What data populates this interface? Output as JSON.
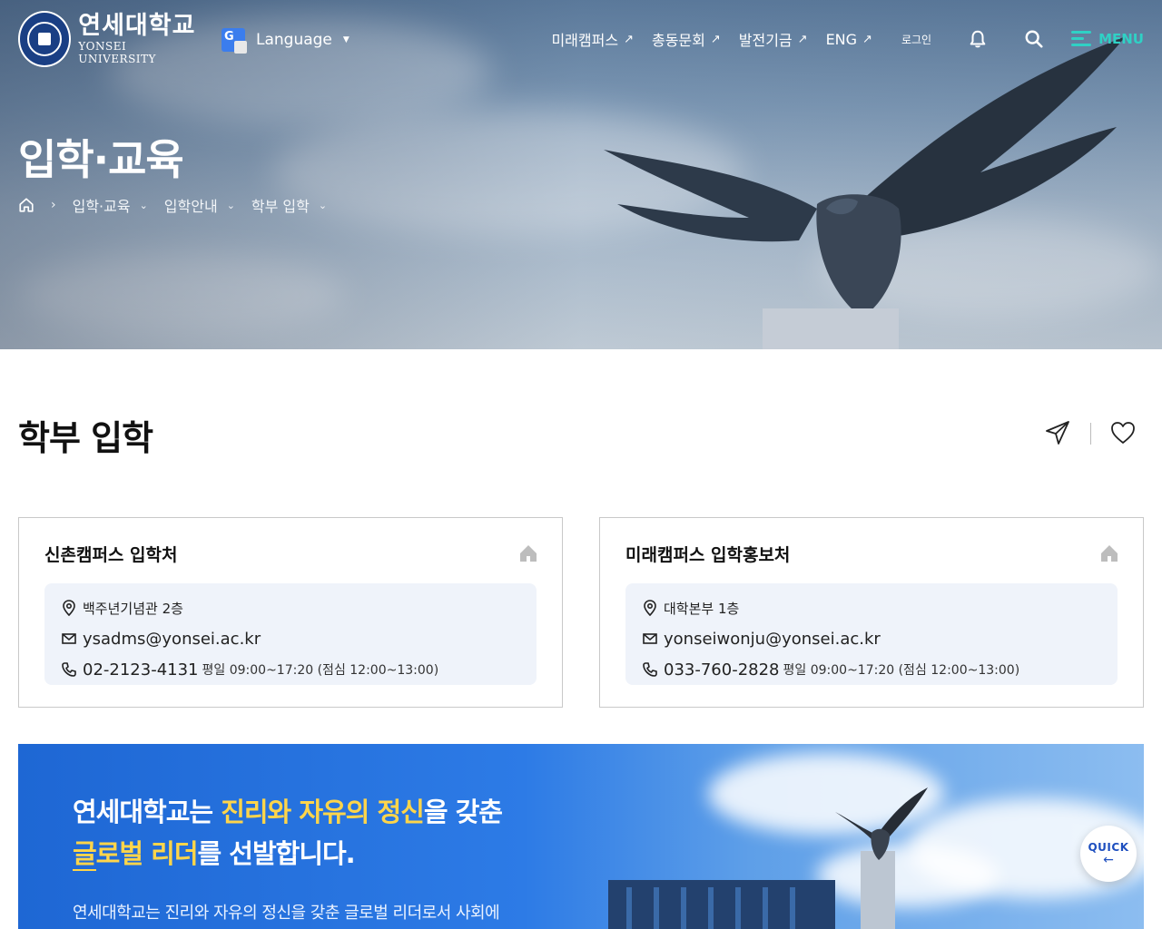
{
  "header": {
    "logo_ko": "연세대학교",
    "logo_en": "YONSEI UNIVERSITY",
    "language_label": "Language",
    "nav": [
      {
        "label": "미래캠퍼스"
      },
      {
        "label": "총동문회"
      },
      {
        "label": "발전기금"
      },
      {
        "label": "ENG"
      }
    ],
    "login_label": "로그인",
    "menu_label": "MENU"
  },
  "hero": {
    "title": "입학·교육",
    "breadcrumb": [
      "입학·교육",
      "입학안내",
      "학부 입학"
    ]
  },
  "page": {
    "title": "학부 입학"
  },
  "cards": [
    {
      "title": "신촌캠퍼스 입학처",
      "location": "백주년기념관 2층",
      "email": "ysadms@yonsei.ac.kr",
      "phone": "02-2123-4131",
      "hours": "평일 09:00~17:20 (점심 12:00~13:00)"
    },
    {
      "title": "미래캠퍼스 입학홍보처",
      "location": "대학본부 1층",
      "email": "yonseiwonju@yonsei.ac.kr",
      "phone": "033-760-2828",
      "hours": "평일 09:00~17:20 (점심 12:00~13:00)"
    }
  ],
  "banner": {
    "line1_a": "연세대학교는 ",
    "line1_hl": "진리와 자유의 정신",
    "line1_b": "을 갖춘",
    "line2_hl": "글로벌 리더",
    "line2_b": "를 선발합니다.",
    "desc": "연세대학교는 진리와 자유의 정신을 갖춘 글로벌 리더로서 사회에"
  },
  "quick": {
    "label": "QUICK",
    "arrow": "←"
  },
  "colors": {
    "brand_navy": "#1a3f84",
    "menu_accent": "#2fd1c5",
    "highlight_yellow": "#ffd54a",
    "banner_blue": "#1e67d4",
    "info_bg": "#eff3fa"
  },
  "icons": {
    "notification": "bell-icon",
    "search": "search-icon",
    "share": "paper-plane-icon",
    "favorite": "heart-icon",
    "location": "map-pin-icon",
    "email": "mail-icon",
    "phone": "phone-icon",
    "card_home": "home-icon"
  }
}
